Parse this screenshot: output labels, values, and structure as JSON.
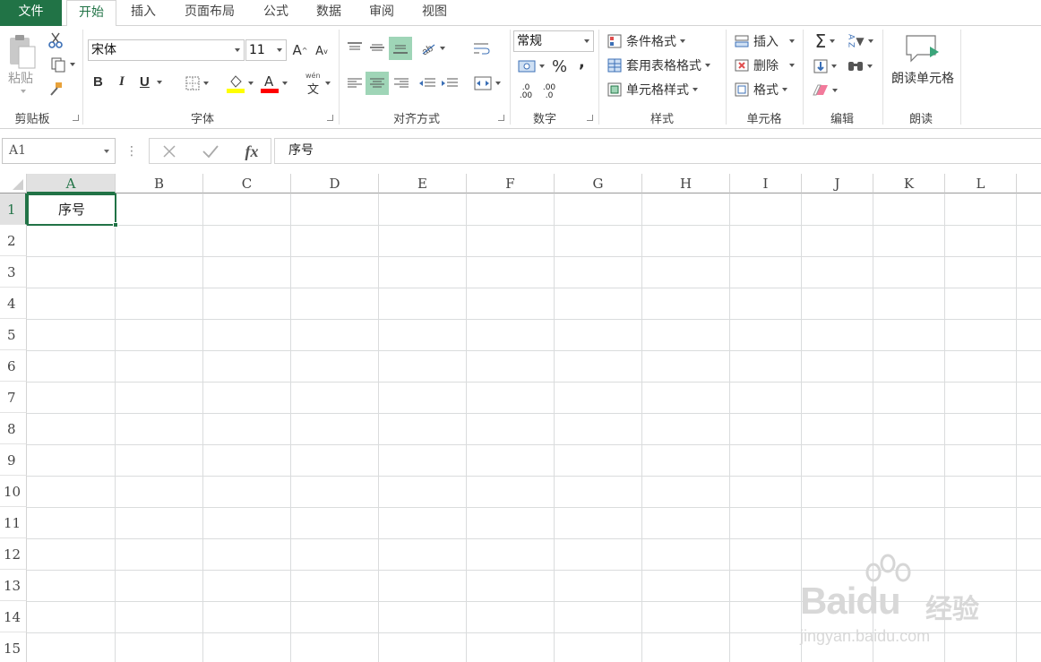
{
  "tabs": [
    "文件",
    "开始",
    "插入",
    "页面布局",
    "公式",
    "数据",
    "审阅",
    "视图"
  ],
  "ribbon": {
    "clipboard": {
      "label": "剪贴板",
      "paste": "粘贴"
    },
    "font": {
      "label": "字体",
      "name": "宋体",
      "size": "11",
      "bold": "B",
      "italic": "I",
      "underline": "U",
      "font_color": "A",
      "phonetic_top": "wén",
      "phonetic": "文"
    },
    "alignment": {
      "label": "对齐方式"
    },
    "number": {
      "label": "数字",
      "format": "常规",
      "percent": "%",
      "comma": ",",
      "inc_decimal_top": ".0",
      "inc_decimal_bottom": ".00",
      "dec_decimal_top": ".00",
      "dec_decimal_bottom": ".0"
    },
    "styles": {
      "label": "样式",
      "conditional": "条件格式",
      "table": "套用表格格式",
      "cell": "单元格样式"
    },
    "cells": {
      "label": "单元格",
      "insert": "插入",
      "delete": "删除",
      "format": "格式"
    },
    "editing": {
      "label": "编辑",
      "sum": "Σ",
      "sort": "A Z"
    },
    "read": {
      "label": "朗读",
      "button": "朗读单元格"
    }
  },
  "formula_bar": {
    "name_box": "A1",
    "fx": "fx",
    "content": "序号"
  },
  "grid": {
    "columns": [
      "A",
      "B",
      "C",
      "D",
      "E",
      "F",
      "G",
      "H",
      "I",
      "J",
      "K",
      "L"
    ],
    "rows": [
      "1",
      "2",
      "3",
      "4",
      "5",
      "6",
      "7",
      "8",
      "9",
      "10",
      "11",
      "12",
      "13",
      "14",
      "15"
    ],
    "cells": {
      "A1": "序号"
    }
  },
  "watermark": {
    "brand": "Baidu",
    "product": "经验",
    "url": "jingyan.baidu.com"
  },
  "colors": {
    "accent": "#217346",
    "highlight": "#9fd5b7",
    "fill_yellow": "#ffff00",
    "font_red": "#ff0000"
  }
}
